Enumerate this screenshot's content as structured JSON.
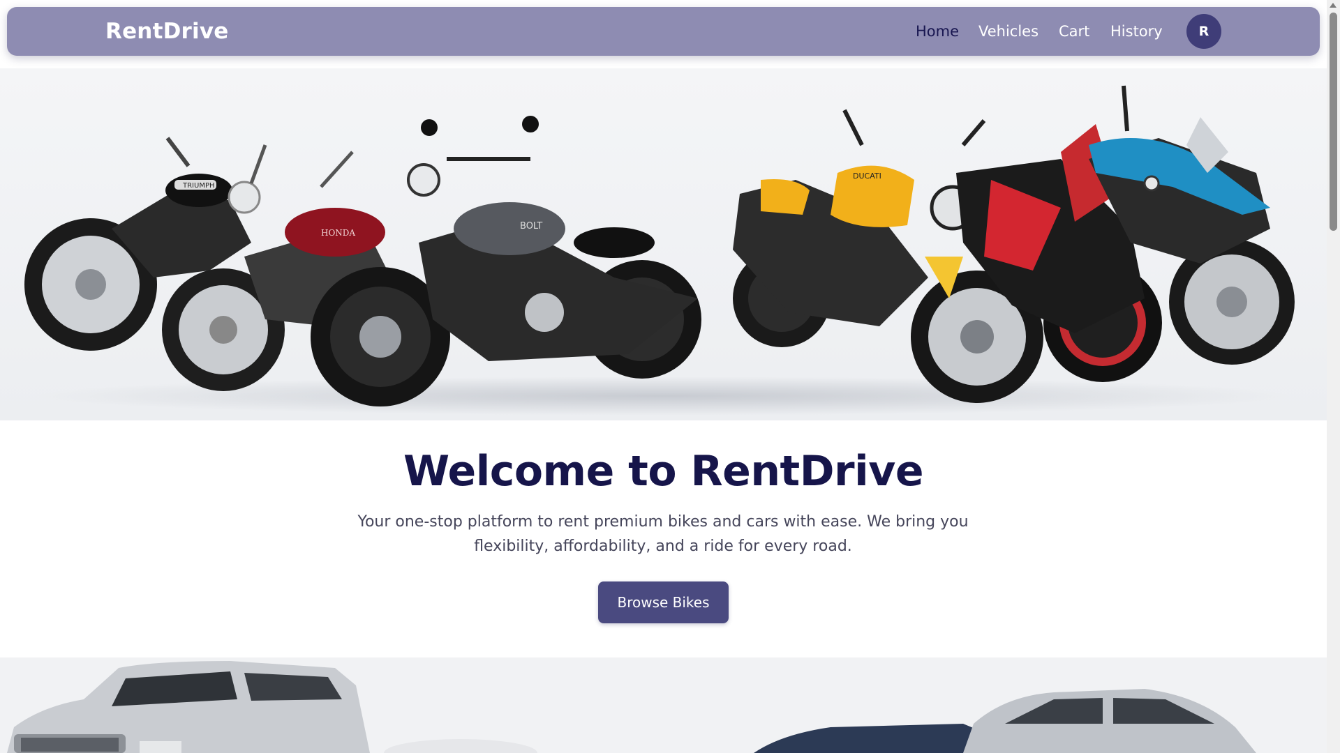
{
  "app": {
    "brand": "RentDrive"
  },
  "nav": {
    "items": [
      {
        "label": "Home",
        "active": true
      },
      {
        "label": "Vehicles",
        "active": false
      },
      {
        "label": "Cart",
        "active": false
      },
      {
        "label": "History",
        "active": false
      }
    ],
    "avatar_initial": "R"
  },
  "hero": {
    "image_icon": "motorcycles-lineup-image",
    "bike_brand_labels": [
      "TRIUMPH",
      "HONDA",
      "BOLT",
      "DUCATI"
    ]
  },
  "welcome": {
    "title": "Welcome to RentDrive",
    "subtitle": "Your one-stop platform to rent premium bikes and cars with ease. We bring you flexibility, affordability, and a ride for every road.",
    "cta_label": "Browse Bikes"
  },
  "cars": {
    "image_icon": "cars-lineup-image"
  },
  "colors": {
    "navbar": "#8e8cb2",
    "title": "#16154a",
    "button": "#4a4a80",
    "avatar": "#3f3d78"
  }
}
